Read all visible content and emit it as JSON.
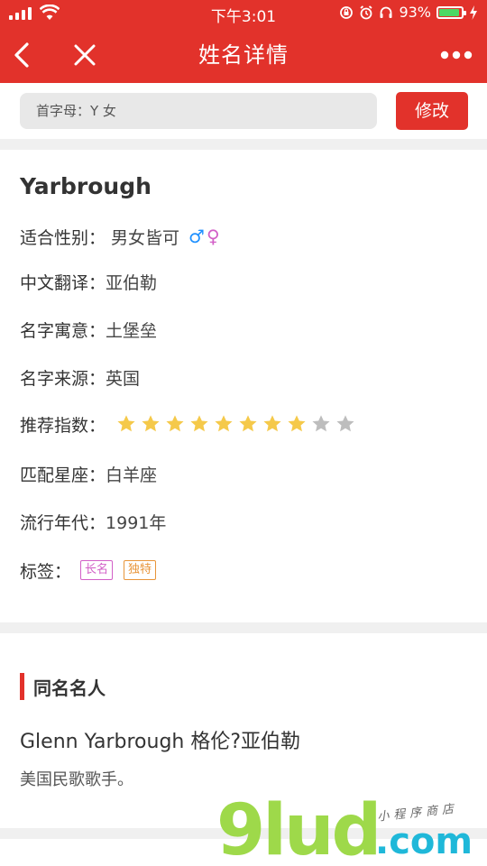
{
  "status_bar": {
    "time": "下午3:01",
    "battery": "93%",
    "battery_level": 0.93
  },
  "nav": {
    "title": "姓名详情"
  },
  "search": {
    "text": "首字母：Y 女",
    "edit_label": "修改"
  },
  "name": {
    "title": "Yarbrough",
    "gender_label": "适合性别：",
    "gender_value": "男女皆可",
    "translation_label": "中文翻译：",
    "translation_value": "亚伯勒",
    "meaning_label": "名字寓意：",
    "meaning_value": "土堡垒",
    "origin_label": "名字来源：",
    "origin_value": "英国",
    "rating_label": "推荐指数：",
    "rating": 8,
    "rating_max": 10,
    "constellation_label": "匹配星座：",
    "constellation_value": "白羊座",
    "era_label": "流行年代：",
    "era_value": "1991年",
    "tags_label": "标签：",
    "tags": [
      "长名",
      "独特"
    ]
  },
  "celebrity": {
    "heading": "同名名人",
    "name": "Glenn Yarbrough 格伦?亚伯勒",
    "description": "美国民歌歌手。"
  },
  "watermark": {
    "main": "9lud",
    "domain": ".com",
    "sub": "小程序商店"
  },
  "colors": {
    "brand": "#e2322b",
    "star_on": "#f5c94a",
    "star_off": "#bdbdbd"
  }
}
